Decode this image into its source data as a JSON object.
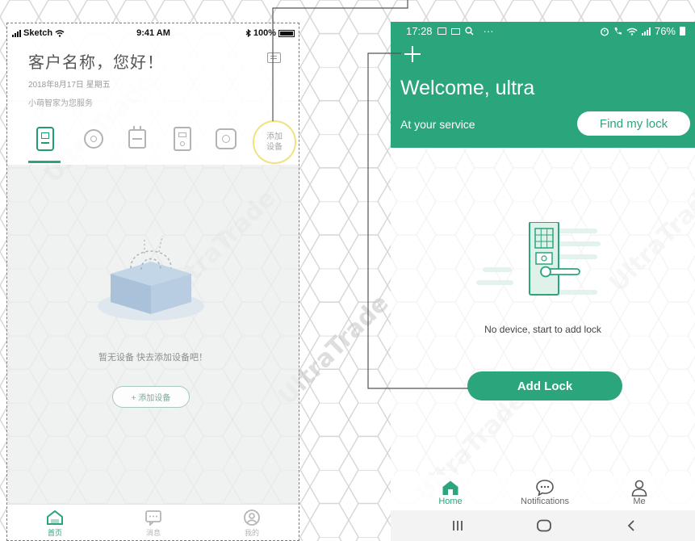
{
  "watermark": "UltraTrade",
  "colors": {
    "brand": "#2aa57c",
    "highlight": "#f0e27c",
    "connector": "#555555"
  },
  "left_phone": {
    "status": {
      "carrier": "Sketch",
      "time": "9:41 AM",
      "battery": "100%"
    },
    "title": "客户名称，您好！",
    "date": "2018年8月17日 星期五",
    "subtitle": "小萌智家为您服务",
    "tabs": [
      {
        "icon": "smart-lock-icon",
        "active": true
      },
      {
        "icon": "camera-icon",
        "active": false
      },
      {
        "icon": "socket-icon",
        "active": false
      },
      {
        "icon": "doorbell-icon",
        "active": false
      },
      {
        "icon": "gateway-icon",
        "active": false
      }
    ],
    "add_device_tab": {
      "line1": "添加",
      "line2": "设备"
    },
    "empty_text": "暂无设备 快去添加设备吧！",
    "add_button": "+ 添加设备",
    "nav": [
      {
        "label": "首页",
        "icon": "home-icon",
        "active": true
      },
      {
        "label": "消息",
        "icon": "message-icon",
        "active": false
      },
      {
        "label": "我的",
        "icon": "user-icon",
        "active": false
      }
    ]
  },
  "right_phone": {
    "status": {
      "time": "17:28",
      "more": "···",
      "battery": "76%"
    },
    "welcome": "Welcome, ultra",
    "service": "At your service",
    "find_button": "Find my lock",
    "empty_text": "No device, start to add lock",
    "add_button": "Add Lock",
    "tabs": [
      {
        "label": "Home",
        "icon": "home-icon",
        "active": true
      },
      {
        "label": "Notifications",
        "icon": "chat-icon",
        "active": false
      },
      {
        "label": "Me",
        "icon": "person-icon",
        "active": false
      }
    ],
    "system_nav": [
      "recent-apps-icon",
      "home-circle-icon",
      "back-icon"
    ]
  }
}
